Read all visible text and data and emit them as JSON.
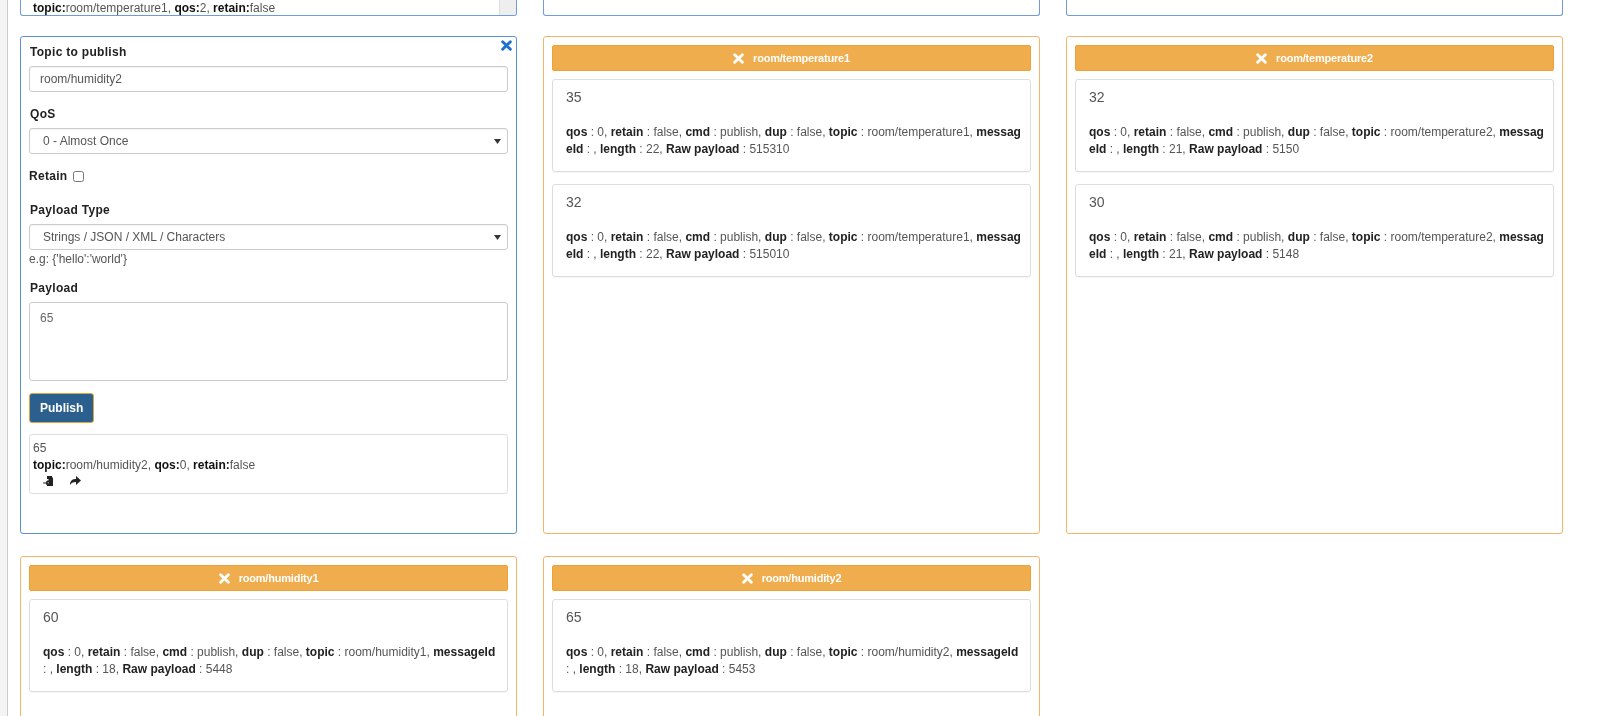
{
  "top_cards": [
    {
      "kind": "log",
      "text": "**topic:**room/temperature1, **qos:**2, **retain:**false"
    },
    {
      "kind": "blank"
    },
    {
      "kind": "blank"
    }
  ],
  "publisher": {
    "topic_label": "Topic to publish",
    "topic": "room/humidity2",
    "qos_label": "QoS",
    "qos": "0 - Almost Once",
    "retain_label": "Retain",
    "retain": false,
    "payload_type_label": "Payload Type",
    "payload_type": "Strings / JSON / XML / Characters",
    "payload_hint": "e.g: {'hello':'world'}",
    "payload_label": "Payload",
    "payload": "65",
    "publish_button": "Publish",
    "log": {
      "payload": "65",
      "meta": "**topic:**room/humidity2, **qos:**0, **retain:**false"
    }
  },
  "subscriptions": [
    {
      "topic": "room/temperature1",
      "messages": [
        {
          "payload": "35",
          "details": "**qos** : 0, **retain** : false, **cmd** : publish, **dup** : false, **topic** : room/temperature1, **messageId** : , **length** : 22, **Raw payload** : 515310"
        },
        {
          "payload": "32",
          "details": "**qos** : 0, **retain** : false, **cmd** : publish, **dup** : false, **topic** : room/temperature1, **messageId** : , **length** : 22, **Raw payload** : 515010"
        }
      ]
    },
    {
      "topic": "room/temperature2",
      "messages": [
        {
          "payload": "32",
          "details": "**qos** : 0, **retain** : false, **cmd** : publish, **dup** : false, **topic** : room/temperature2, **messageId** : , **length** : 21, **Raw payload** : 5150"
        },
        {
          "payload": "30",
          "details": "**qos** : 0, **retain** : false, **cmd** : publish, **dup** : false, **topic** : room/temperature2, **messageId** : , **length** : 21, **Raw payload** : 5148"
        }
      ]
    },
    {
      "topic": "room/humidity1",
      "messages": [
        {
          "payload": "60",
          "details": "**qos** : 0, **retain** : false, **cmd** : publish, **dup** : false, **topic** : room/humidity1, **messageId** : , **length** : 18, **Raw payload** : 5448"
        }
      ]
    },
    {
      "topic": "room/humidity2",
      "messages": [
        {
          "payload": "65",
          "details": "**qos** : 0, **retain** : false, **cmd** : publish, **dup** : false, **topic** : room/humidity2, **messageId** : , **length** : 18, **Raw payload** : 5453"
        }
      ]
    }
  ]
}
